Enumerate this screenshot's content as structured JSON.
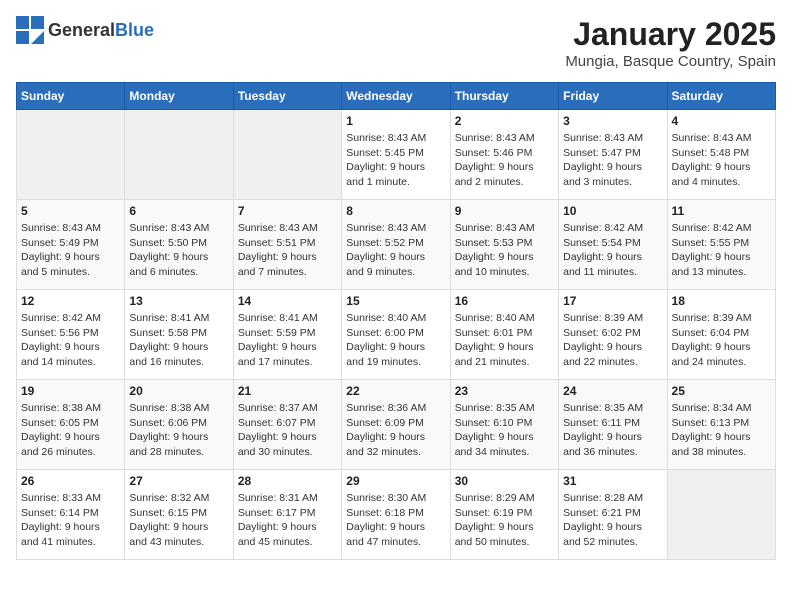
{
  "logo": {
    "general": "General",
    "blue": "Blue"
  },
  "title": "January 2025",
  "subtitle": "Mungia, Basque Country, Spain",
  "weekdays": [
    "Sunday",
    "Monday",
    "Tuesday",
    "Wednesday",
    "Thursday",
    "Friday",
    "Saturday"
  ],
  "weeks": [
    [
      {
        "day": "",
        "info": ""
      },
      {
        "day": "",
        "info": ""
      },
      {
        "day": "",
        "info": ""
      },
      {
        "day": "1",
        "info": "Sunrise: 8:43 AM\nSunset: 5:45 PM\nDaylight: 9 hours\nand 1 minute."
      },
      {
        "day": "2",
        "info": "Sunrise: 8:43 AM\nSunset: 5:46 PM\nDaylight: 9 hours\nand 2 minutes."
      },
      {
        "day": "3",
        "info": "Sunrise: 8:43 AM\nSunset: 5:47 PM\nDaylight: 9 hours\nand 3 minutes."
      },
      {
        "day": "4",
        "info": "Sunrise: 8:43 AM\nSunset: 5:48 PM\nDaylight: 9 hours\nand 4 minutes."
      }
    ],
    [
      {
        "day": "5",
        "info": "Sunrise: 8:43 AM\nSunset: 5:49 PM\nDaylight: 9 hours\nand 5 minutes."
      },
      {
        "day": "6",
        "info": "Sunrise: 8:43 AM\nSunset: 5:50 PM\nDaylight: 9 hours\nand 6 minutes."
      },
      {
        "day": "7",
        "info": "Sunrise: 8:43 AM\nSunset: 5:51 PM\nDaylight: 9 hours\nand 7 minutes."
      },
      {
        "day": "8",
        "info": "Sunrise: 8:43 AM\nSunset: 5:52 PM\nDaylight: 9 hours\nand 9 minutes."
      },
      {
        "day": "9",
        "info": "Sunrise: 8:43 AM\nSunset: 5:53 PM\nDaylight: 9 hours\nand 10 minutes."
      },
      {
        "day": "10",
        "info": "Sunrise: 8:42 AM\nSunset: 5:54 PM\nDaylight: 9 hours\nand 11 minutes."
      },
      {
        "day": "11",
        "info": "Sunrise: 8:42 AM\nSunset: 5:55 PM\nDaylight: 9 hours\nand 13 minutes."
      }
    ],
    [
      {
        "day": "12",
        "info": "Sunrise: 8:42 AM\nSunset: 5:56 PM\nDaylight: 9 hours\nand 14 minutes."
      },
      {
        "day": "13",
        "info": "Sunrise: 8:41 AM\nSunset: 5:58 PM\nDaylight: 9 hours\nand 16 minutes."
      },
      {
        "day": "14",
        "info": "Sunrise: 8:41 AM\nSunset: 5:59 PM\nDaylight: 9 hours\nand 17 minutes."
      },
      {
        "day": "15",
        "info": "Sunrise: 8:40 AM\nSunset: 6:00 PM\nDaylight: 9 hours\nand 19 minutes."
      },
      {
        "day": "16",
        "info": "Sunrise: 8:40 AM\nSunset: 6:01 PM\nDaylight: 9 hours\nand 21 minutes."
      },
      {
        "day": "17",
        "info": "Sunrise: 8:39 AM\nSunset: 6:02 PM\nDaylight: 9 hours\nand 22 minutes."
      },
      {
        "day": "18",
        "info": "Sunrise: 8:39 AM\nSunset: 6:04 PM\nDaylight: 9 hours\nand 24 minutes."
      }
    ],
    [
      {
        "day": "19",
        "info": "Sunrise: 8:38 AM\nSunset: 6:05 PM\nDaylight: 9 hours\nand 26 minutes."
      },
      {
        "day": "20",
        "info": "Sunrise: 8:38 AM\nSunset: 6:06 PM\nDaylight: 9 hours\nand 28 minutes."
      },
      {
        "day": "21",
        "info": "Sunrise: 8:37 AM\nSunset: 6:07 PM\nDaylight: 9 hours\nand 30 minutes."
      },
      {
        "day": "22",
        "info": "Sunrise: 8:36 AM\nSunset: 6:09 PM\nDaylight: 9 hours\nand 32 minutes."
      },
      {
        "day": "23",
        "info": "Sunrise: 8:35 AM\nSunset: 6:10 PM\nDaylight: 9 hours\nand 34 minutes."
      },
      {
        "day": "24",
        "info": "Sunrise: 8:35 AM\nSunset: 6:11 PM\nDaylight: 9 hours\nand 36 minutes."
      },
      {
        "day": "25",
        "info": "Sunrise: 8:34 AM\nSunset: 6:13 PM\nDaylight: 9 hours\nand 38 minutes."
      }
    ],
    [
      {
        "day": "26",
        "info": "Sunrise: 8:33 AM\nSunset: 6:14 PM\nDaylight: 9 hours\nand 41 minutes."
      },
      {
        "day": "27",
        "info": "Sunrise: 8:32 AM\nSunset: 6:15 PM\nDaylight: 9 hours\nand 43 minutes."
      },
      {
        "day": "28",
        "info": "Sunrise: 8:31 AM\nSunset: 6:17 PM\nDaylight: 9 hours\nand 45 minutes."
      },
      {
        "day": "29",
        "info": "Sunrise: 8:30 AM\nSunset: 6:18 PM\nDaylight: 9 hours\nand 47 minutes."
      },
      {
        "day": "30",
        "info": "Sunrise: 8:29 AM\nSunset: 6:19 PM\nDaylight: 9 hours\nand 50 minutes."
      },
      {
        "day": "31",
        "info": "Sunrise: 8:28 AM\nSunset: 6:21 PM\nDaylight: 9 hours\nand 52 minutes."
      },
      {
        "day": "",
        "info": ""
      }
    ]
  ]
}
